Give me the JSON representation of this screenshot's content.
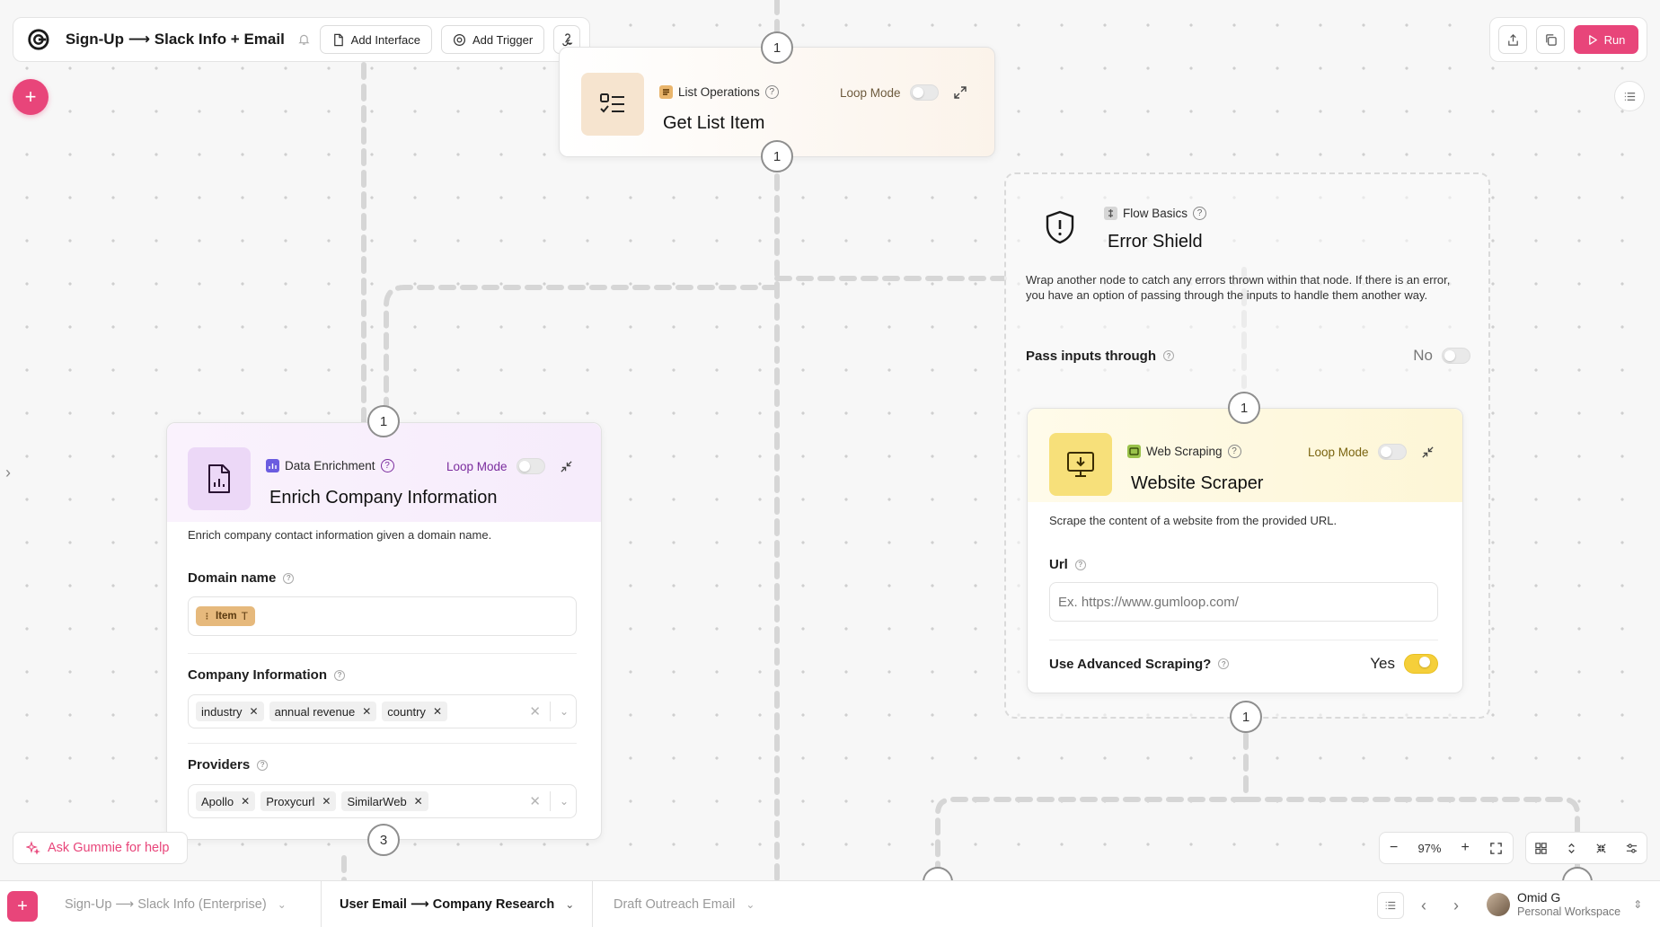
{
  "toolbar": {
    "flow_title": "Sign-Up ⟶ Slack Info + Email",
    "add_interface": "Add Interface",
    "add_trigger": "Add Trigger",
    "run": "Run"
  },
  "nodes": {
    "list_item": {
      "category": "List Operations",
      "title": "Get List Item",
      "loop_mode": "Loop Mode",
      "loop_on": false
    },
    "error_shield": {
      "category": "Flow Basics",
      "title": "Error Shield",
      "description": "Wrap another node to catch any errors thrown within that node. If there is an error, you have an option of passing through the inputs to handle them another way.",
      "pass_label": "Pass inputs through",
      "pass_value": "No"
    },
    "enrich": {
      "category": "Data Enrichment",
      "title": "Enrich Company Information",
      "loop_mode": "Loop Mode",
      "description": "Enrich company contact information given a domain name.",
      "domain_label": "Domain name",
      "domain_chip": "Item",
      "company_label": "Company Information",
      "company_chips": [
        "industry",
        "annual revenue",
        "country"
      ],
      "providers_label": "Providers",
      "provider_chips": [
        "Apollo",
        "Proxycurl",
        "SimilarWeb"
      ]
    },
    "scraper": {
      "category": "Web Scraping",
      "title": "Website Scraper",
      "loop_mode": "Loop Mode",
      "description": "Scrape the content of a website from the provided URL.",
      "url_label": "Url",
      "url_placeholder": "Ex. https://www.gumloop.com/",
      "advanced_label": "Use Advanced Scraping?",
      "advanced_value": "Yes"
    }
  },
  "badges": {
    "top_in": "1",
    "list_out": "1",
    "enrich_in": "1",
    "enrich_out": "3",
    "scraper_in": "1",
    "scraper_out": "1"
  },
  "controls": {
    "ask": "Ask Gummie for help",
    "zoom": "97%"
  },
  "tabs": {
    "items": [
      {
        "label": "Sign-Up ⟶ Slack Info (Enterprise)",
        "active": false
      },
      {
        "label": "User Email ⟶ Company Research",
        "active": true
      },
      {
        "label": "Draft Outreach Email",
        "active": false
      }
    ]
  },
  "user": {
    "name": "Omid G",
    "workspace": "Personal Workspace"
  },
  "colors": {
    "accent": "#e8457a",
    "enrich_tint": "#f3e8fb",
    "enrich_loop": "#7a2c9e",
    "scraper_tint": "#fdf9e3",
    "list_tint": "#f6e4cf",
    "toggle_on": "#f5cf3a"
  }
}
